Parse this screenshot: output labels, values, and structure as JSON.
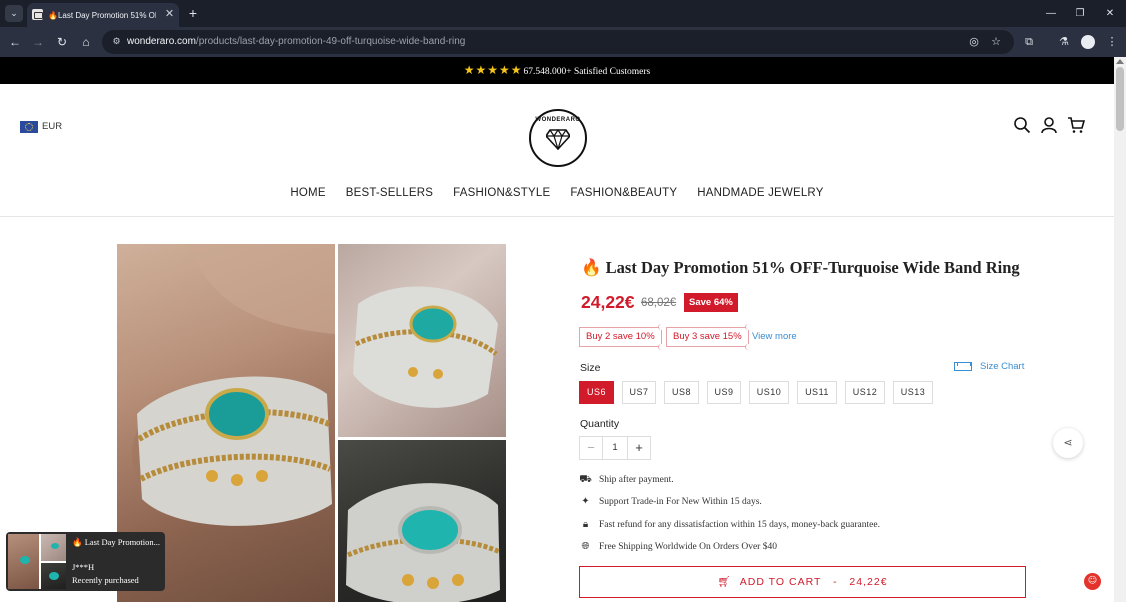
{
  "browser": {
    "tab_title": "Last Day Promotion 51% OF",
    "url_host": "wonderaro.com",
    "url_path": "/products/last-day-promotion-49-off-turquoise-wide-band-ring"
  },
  "announcement": {
    "stars": "★★★★★",
    "text": "67.548.000+ Satisfied Customers"
  },
  "header": {
    "currency": "EUR",
    "logo_text": "WONDERARO"
  },
  "nav": {
    "items": [
      "HOME",
      "BEST-SELLERS",
      "FASHION&STYLE",
      "FASHION&BEAUTY",
      "HANDMADE JEWELRY"
    ]
  },
  "product": {
    "title": "Last Day Promotion 51% OFF-Turquoise Wide Band Ring",
    "price": "24,22€",
    "compare_price": "68,02€",
    "save_badge": "Save 64%",
    "offers": [
      "Buy 2 save 10%",
      "Buy 3 save 15%"
    ],
    "view_more": "View more",
    "size_label": "Size",
    "size_chart": "Size Chart",
    "sizes": [
      "US6",
      "US7",
      "US8",
      "US9",
      "US10",
      "US11",
      "US12",
      "US13"
    ],
    "selected_size": "US6",
    "quantity_label": "Quantity",
    "quantity": "1",
    "features": [
      "Ship after payment.",
      "Support Trade-in For New Within 15 days.",
      "Fast refund for any dissatisfaction within 15 days, money-back guarantee.",
      "Free Shipping Worldwide On Orders Over $40"
    ],
    "cart_label": "ADD TO CART",
    "cart_separator": "-",
    "cart_price": "24,22€"
  },
  "popup": {
    "title": "Last Day Promotion...",
    "name": "J***H",
    "subtitle": "Recently purchased"
  },
  "colors": {
    "accent": "#d11a2a",
    "link": "#3a8ed4",
    "announcement_bg": "#000000"
  }
}
